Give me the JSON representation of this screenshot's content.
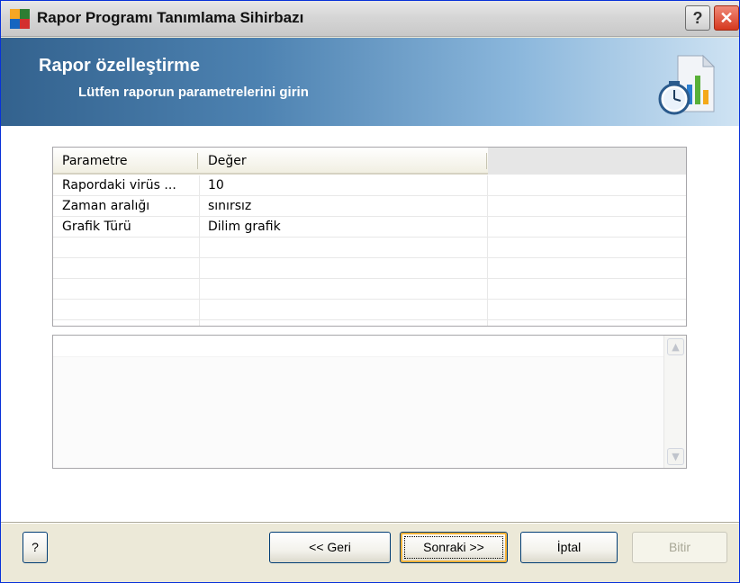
{
  "window": {
    "title": "Rapor Programı Tanımlama Sihirbazı",
    "help_button": "?",
    "close_button": "✕"
  },
  "header": {
    "title": "Rapor özelleştirme",
    "subtitle": "Lütfen raporun parametrelerini girin",
    "icon": "report-schedule-icon"
  },
  "grid": {
    "columns": [
      "Parametre",
      "Değer"
    ],
    "rows": [
      {
        "param": "Rapordaki virüs ...",
        "value": "10"
      },
      {
        "param": "Zaman aralığı",
        "value": "sınırsız"
      },
      {
        "param": "Grafik Türü",
        "value": "Dilim grafik"
      },
      {
        "param": "",
        "value": ""
      },
      {
        "param": "",
        "value": ""
      },
      {
        "param": "",
        "value": ""
      },
      {
        "param": "",
        "value": ""
      }
    ]
  },
  "description": {
    "text": ""
  },
  "footer": {
    "help_label": "?",
    "back_label": "<< Geri",
    "next_label": "Sonraki >>",
    "cancel_label": "İptal",
    "finish_label": "Bitir"
  },
  "colors": {
    "title_close": "#d5381e",
    "banner_start": "#33628e",
    "banner_end": "#cfe3f3",
    "button_border": "#003c74"
  }
}
